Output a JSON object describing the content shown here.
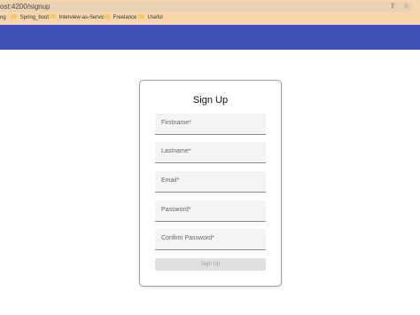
{
  "browser": {
    "url": "ost:4200/signup",
    "bookmarks": [
      {
        "label": "ng"
      },
      {
        "label": "Spring_boot"
      },
      {
        "label": "Interview-as-Service"
      },
      {
        "label": "Freelance"
      },
      {
        "label": "Useful"
      }
    ]
  },
  "form": {
    "title": "Sign Up",
    "fields": [
      {
        "label": "Firstname*"
      },
      {
        "label": "Lastname*"
      },
      {
        "label": "Email*"
      },
      {
        "label": "Password*"
      },
      {
        "label": "Confirm Password*"
      }
    ],
    "submit_label": "Sign Up"
  },
  "colors": {
    "app_bar": "#3f51b5",
    "browser_chrome": "#f6d7ad"
  }
}
